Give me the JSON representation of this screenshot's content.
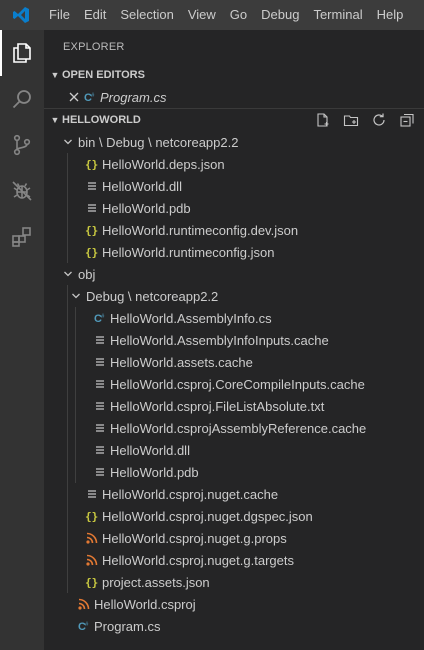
{
  "menu": [
    "File",
    "Edit",
    "Selection",
    "View",
    "Go",
    "Debug",
    "Terminal",
    "Help"
  ],
  "sidebar": {
    "title": "EXPLORER",
    "open_editors": {
      "label": "OPEN EDITORS",
      "files": [
        {
          "name": "Program.cs",
          "icon": "csharp"
        }
      ]
    },
    "folder": {
      "label": "HELLOWORLD",
      "actions": [
        "new-file-icon",
        "new-folder-icon",
        "refresh-icon",
        "collapse-all-icon"
      ]
    }
  },
  "tree": [
    {
      "level": 0,
      "kind": "folder",
      "name": "bin \\ Debug \\ netcoreapp2.2"
    },
    {
      "level": 1,
      "kind": "file",
      "icon": "json",
      "name": "HelloWorld.deps.json"
    },
    {
      "level": 1,
      "kind": "file",
      "icon": "lines",
      "name": "HelloWorld.dll"
    },
    {
      "level": 1,
      "kind": "file",
      "icon": "lines",
      "name": "HelloWorld.pdb"
    },
    {
      "level": 1,
      "kind": "file",
      "icon": "json",
      "name": "HelloWorld.runtimeconfig.dev.json"
    },
    {
      "level": 1,
      "kind": "file",
      "icon": "json",
      "name": "HelloWorld.runtimeconfig.json"
    },
    {
      "level": 0,
      "kind": "folder",
      "name": "obj"
    },
    {
      "level": 1,
      "kind": "folder",
      "name": "Debug \\ netcoreapp2.2"
    },
    {
      "level": 2,
      "kind": "file",
      "icon": "csharp",
      "name": "HelloWorld.AssemblyInfo.cs"
    },
    {
      "level": 2,
      "kind": "file",
      "icon": "lines",
      "name": "HelloWorld.AssemblyInfoInputs.cache"
    },
    {
      "level": 2,
      "kind": "file",
      "icon": "lines",
      "name": "HelloWorld.assets.cache"
    },
    {
      "level": 2,
      "kind": "file",
      "icon": "lines",
      "name": "HelloWorld.csproj.CoreCompileInputs.cache"
    },
    {
      "level": 2,
      "kind": "file",
      "icon": "lines",
      "name": "HelloWorld.csproj.FileListAbsolute.txt"
    },
    {
      "level": 2,
      "kind": "file",
      "icon": "lines",
      "name": "HelloWorld.csprojAssemblyReference.cache"
    },
    {
      "level": 2,
      "kind": "file",
      "icon": "lines",
      "name": "HelloWorld.dll"
    },
    {
      "level": 2,
      "kind": "file",
      "icon": "lines",
      "name": "HelloWorld.pdb"
    },
    {
      "level": 1,
      "kind": "file",
      "icon": "lines",
      "name": "HelloWorld.csproj.nuget.cache"
    },
    {
      "level": 1,
      "kind": "file",
      "icon": "json",
      "name": "HelloWorld.csproj.nuget.dgspec.json"
    },
    {
      "level": 1,
      "kind": "file",
      "icon": "rss",
      "name": "HelloWorld.csproj.nuget.g.props"
    },
    {
      "level": 1,
      "kind": "file",
      "icon": "rss",
      "name": "HelloWorld.csproj.nuget.g.targets"
    },
    {
      "level": 1,
      "kind": "file",
      "icon": "json",
      "name": "project.assets.json"
    },
    {
      "level": 0,
      "kind": "file",
      "icon": "rss",
      "name": "HelloWorld.csproj"
    },
    {
      "level": 0,
      "kind": "file",
      "icon": "csharp",
      "name": "Program.cs"
    }
  ],
  "colors": {
    "titlebar": "#3c3c3c",
    "activitybar": "#333333",
    "sidebar": "#252526",
    "vscode_blue": "#0a7ecc",
    "json_icon": "#cbcb41",
    "csharp_icon": "#519aba",
    "rss_icon": "#e37933"
  }
}
